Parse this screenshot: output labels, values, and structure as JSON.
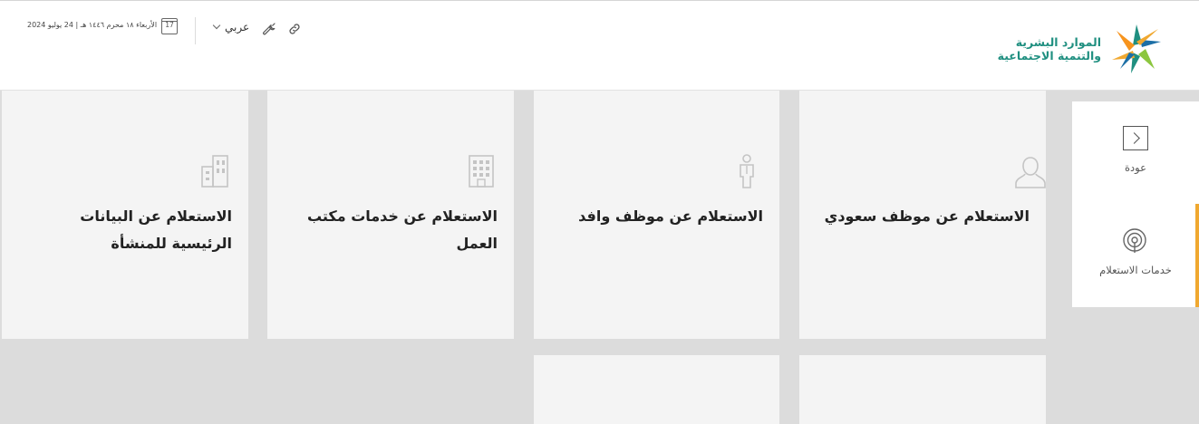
{
  "header": {
    "org_line1": "الموارد البشرية",
    "org_line2": "والتنمية الاجتماعية",
    "date_text": "الأربعاء ١٨ محرم ١٤٤٦ هـ | 24 يوليو 2024",
    "calendar_day": "17",
    "language_label": "عربي"
  },
  "sidebar": {
    "back_label": "عودة",
    "services_label": "خدمات الاستعلام",
    "active_color": "#f0a830"
  },
  "cards": [
    {
      "title": "الاستعلام عن موظف سعودي",
      "icon": "user-icon"
    },
    {
      "title": "الاستعلام عن موظف وافد",
      "icon": "person-icon"
    },
    {
      "title": "الاستعلام عن خدمات مكتب العمل",
      "icon": "building-icon"
    },
    {
      "title": "الاستعلام عن البيانات الرئيسية للمنشأة",
      "icon": "buildings-icon"
    }
  ],
  "colors": {
    "brand_green": "#1f8f80",
    "brand_orange": "#f0a830",
    "background": "#dcdcdc",
    "card": "#f4f4f4"
  }
}
